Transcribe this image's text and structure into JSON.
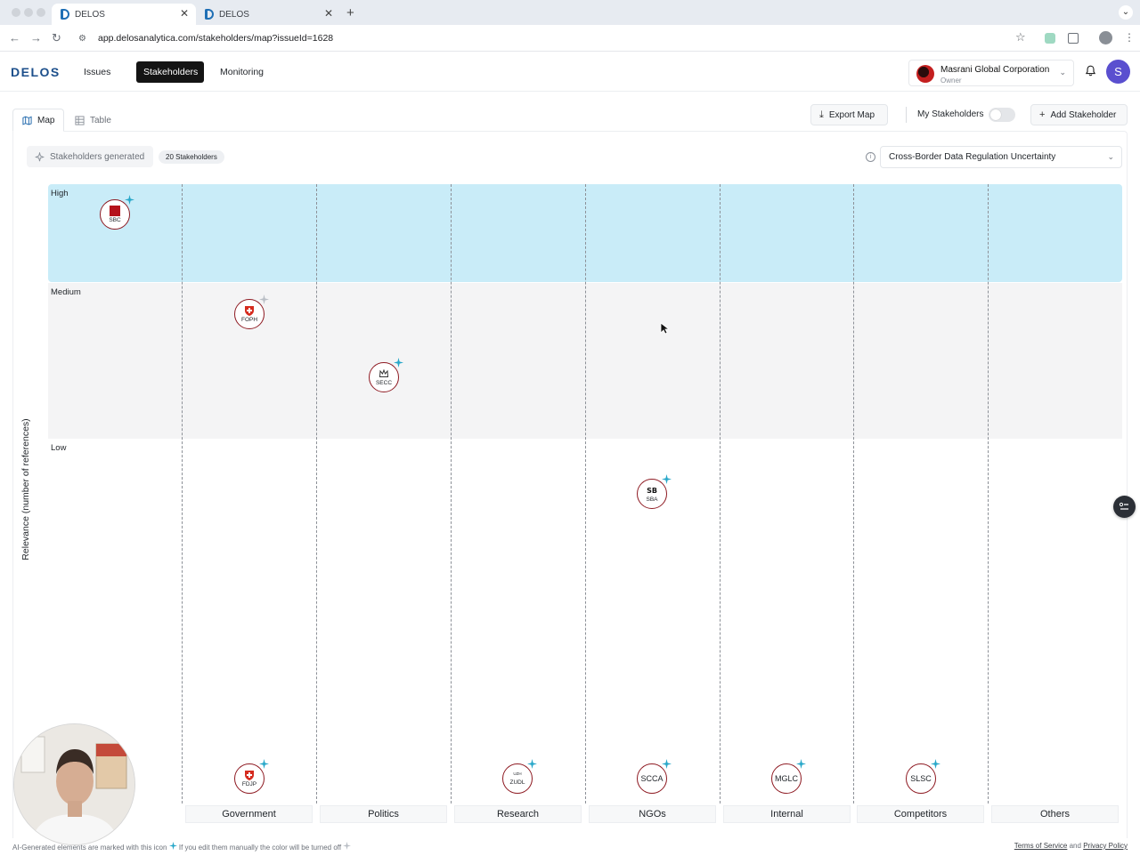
{
  "browser": {
    "tabs": [
      {
        "title": "DELOS",
        "active": true
      },
      {
        "title": "DELOS",
        "active": false
      }
    ],
    "url": "app.delosanalytica.com/stakeholders/map?issueId=1628"
  },
  "header": {
    "logo": "DELOS",
    "nav": [
      "Issues",
      "Stakeholders",
      "Monitoring"
    ],
    "active_nav": "Stakeholders",
    "org_name": "Masrani Global Corporation",
    "org_role": "Owner",
    "avatar_initial": "S"
  },
  "toolbar": {
    "view_tabs": [
      "Map",
      "Table"
    ],
    "active_view": "Map",
    "export_label": "Export Map",
    "my_stakeholders_label": "My Stakeholders",
    "my_stakeholders_on": false,
    "add_label": "Add Stakeholder"
  },
  "status": {
    "generated_label": "Stakeholders generated",
    "count_label": "20 Stakeholders",
    "issue": "Cross-Border Data Regulation Uncertainty"
  },
  "map": {
    "y_axis_label": "Relevance (number of references)",
    "bands": [
      "High",
      "Medium",
      "Low"
    ],
    "columns": [
      "Government",
      "Politics",
      "Research",
      "NGOs",
      "Internal",
      "Competitors",
      "Others"
    ],
    "nodes": [
      {
        "code": "SBC",
        "glyph": "flag-square"
      },
      {
        "code": "FOPH",
        "glyph": "swiss-shield"
      },
      {
        "code": "SECC",
        "glyph": "crown"
      },
      {
        "code": "SBA",
        "glyph": "sb-mark"
      },
      {
        "code": "FDJP",
        "glyph": "swiss-shield"
      },
      {
        "code": "ZUDL",
        "glyph": "uzh-mark",
        "mark_text": "UZH"
      },
      {
        "code": "SCCA",
        "glyph": "none"
      },
      {
        "code": "MGLC",
        "glyph": "none"
      },
      {
        "code": "SLSC",
        "glyph": "none"
      }
    ]
  },
  "footer": {
    "note_prefix": "AI-Generated elements are marked with this icon",
    "note_suffix": "If you edit them manually the color will be turned off",
    "terms": "Terms of Service",
    "and": "and",
    "privacy": "Privacy Policy"
  },
  "colors": {
    "brand": "#1c4f8b",
    "high_band": "#c9ecf8",
    "medium_band": "#f4f4f5",
    "node_ring": "#8e1a22",
    "ai_spark": "#27a7c9"
  }
}
